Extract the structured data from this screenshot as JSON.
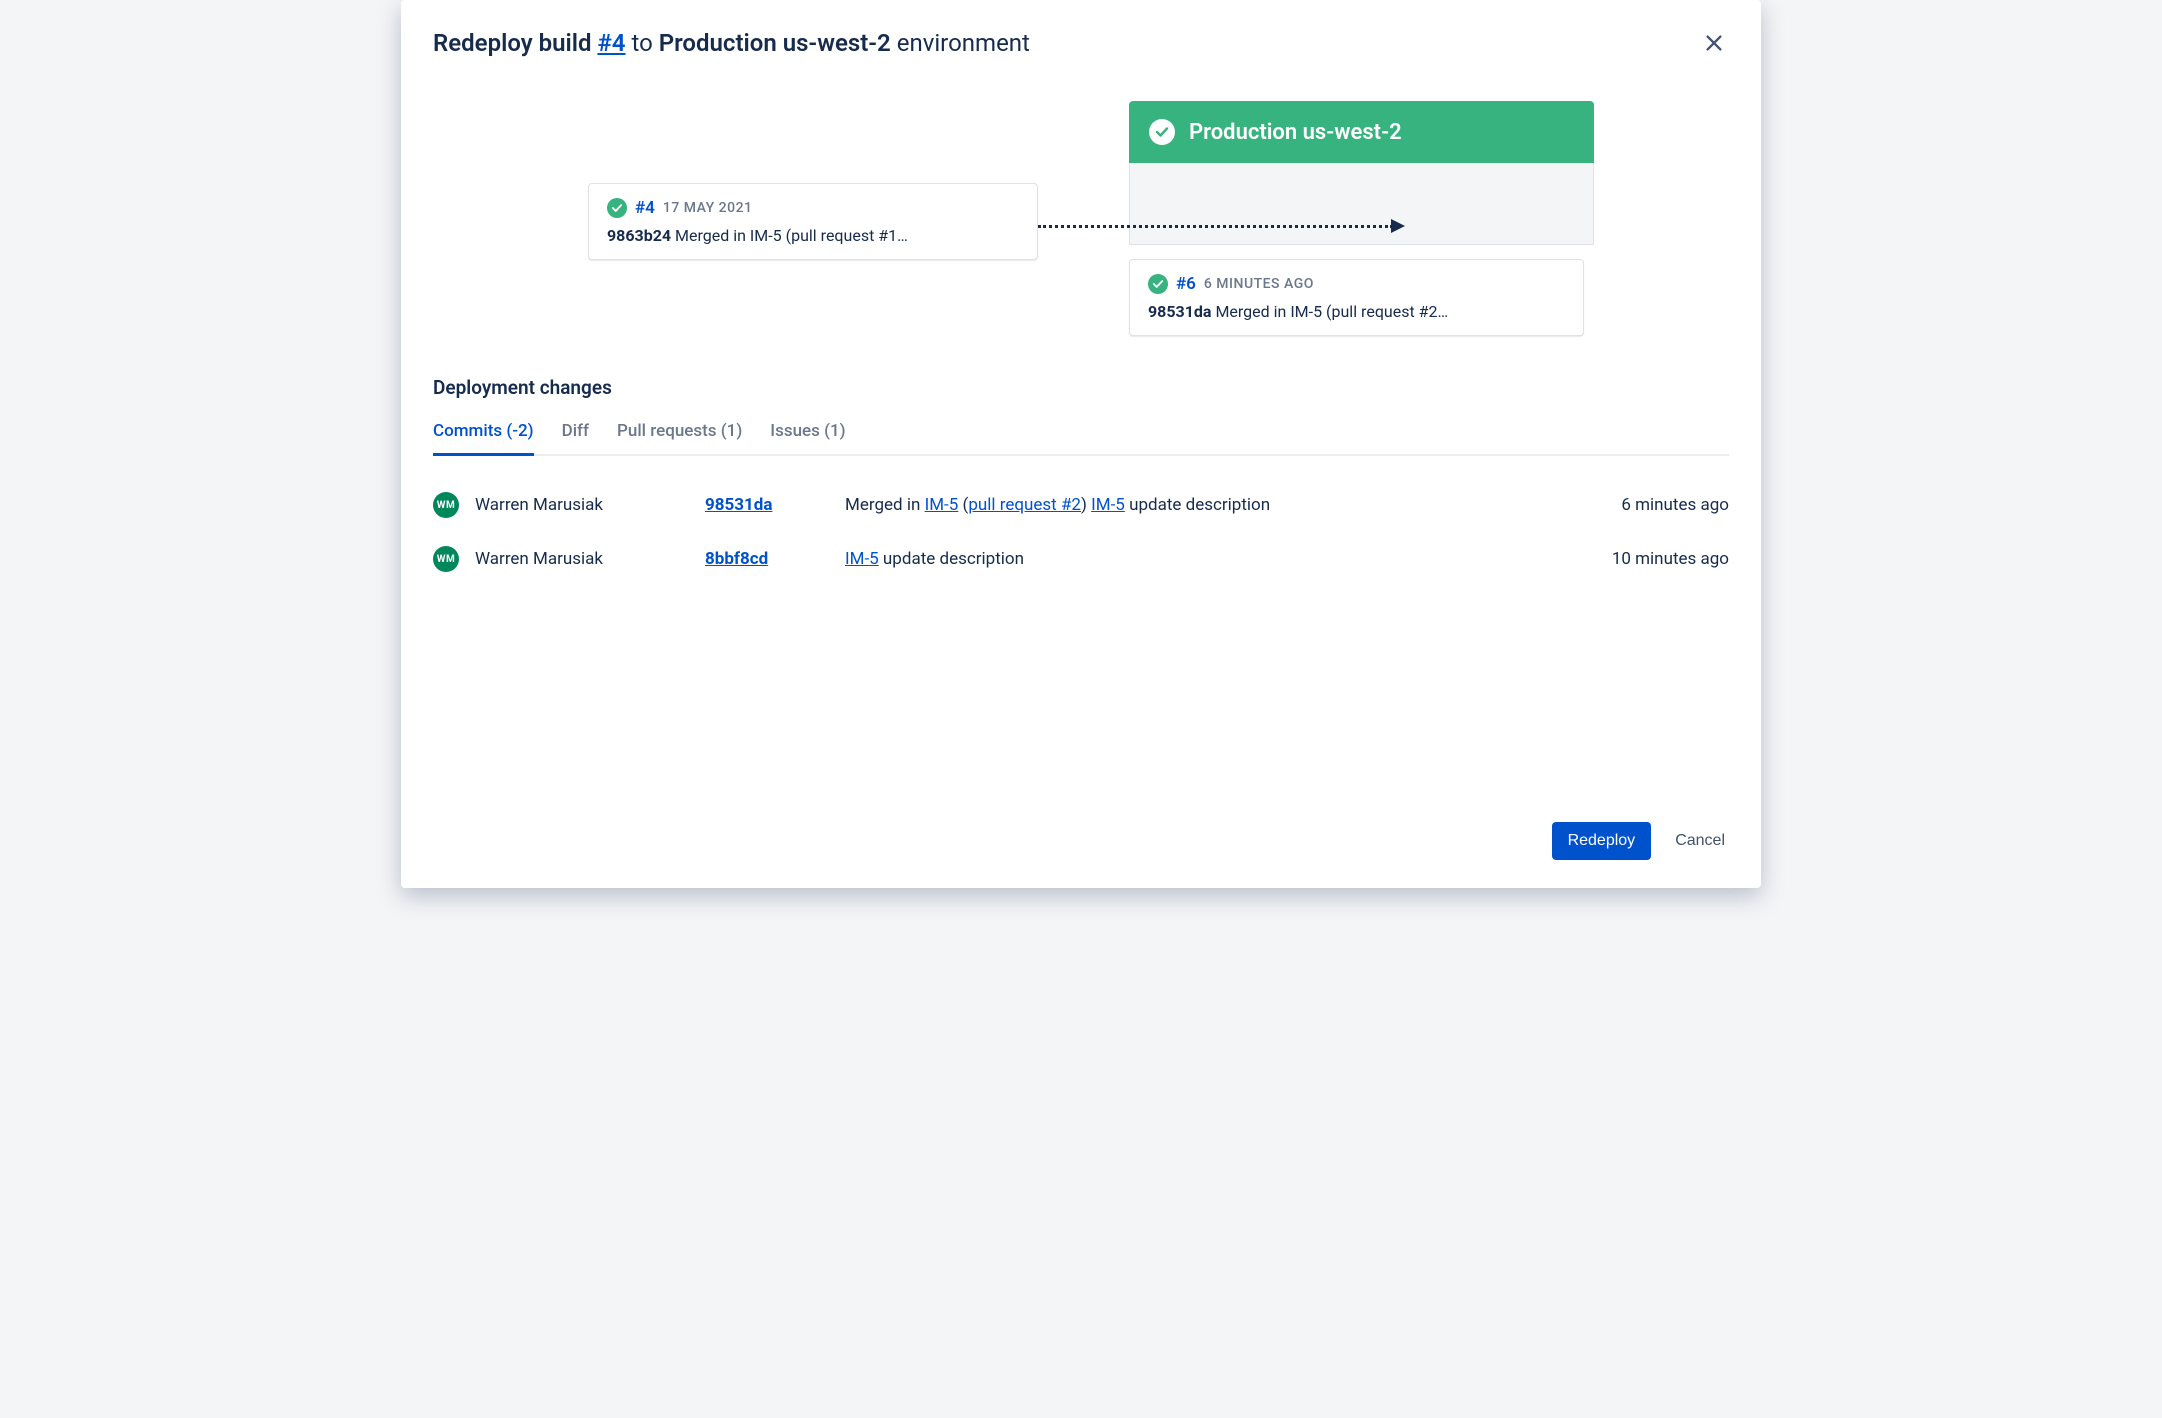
{
  "header": {
    "title_prefix": "Redeploy build ",
    "build_link": "#4",
    "title_mid": " to ",
    "env_strong": "Production us-west-2",
    "title_suffix": " environment"
  },
  "source_build": {
    "number": "#4",
    "date": "17 MAY 2021",
    "hash": "9863b24",
    "msg": " Merged in IM-5 (pull request #1…"
  },
  "target_env": {
    "name": "Production us-west-2"
  },
  "current_build": {
    "number": "#6",
    "date": "6 MINUTES AGO",
    "hash": "98531da",
    "msg": " Merged in IM-5 (pull request #2…"
  },
  "section_title": "Deployment changes",
  "tabs": {
    "commits": "Commits (-2)",
    "diff": "Diff",
    "pull_requests": "Pull requests (1)",
    "issues": "Issues (1)"
  },
  "commits": [
    {
      "avatar": "WM",
      "author": "Warren Marusiak",
      "hash": "98531da",
      "msg_pre": "Merged in ",
      "msg_link1": "IM-5",
      "msg_paren_open": " (",
      "msg_link2": "pull request #2",
      "msg_paren_close": ") ",
      "msg_link3": "IM-5",
      "msg_tail": " update description",
      "time": "6 minutes ago"
    },
    {
      "avatar": "WM",
      "author": "Warren Marusiak",
      "hash": "8bbf8cd",
      "msg_pre": "",
      "msg_link1": "IM-5",
      "msg_paren_open": "",
      "msg_link2": "",
      "msg_paren_close": "",
      "msg_link3": "",
      "msg_tail": " update description",
      "time": "10 minutes ago"
    }
  ],
  "footer": {
    "primary": "Redeploy",
    "secondary": "Cancel"
  }
}
